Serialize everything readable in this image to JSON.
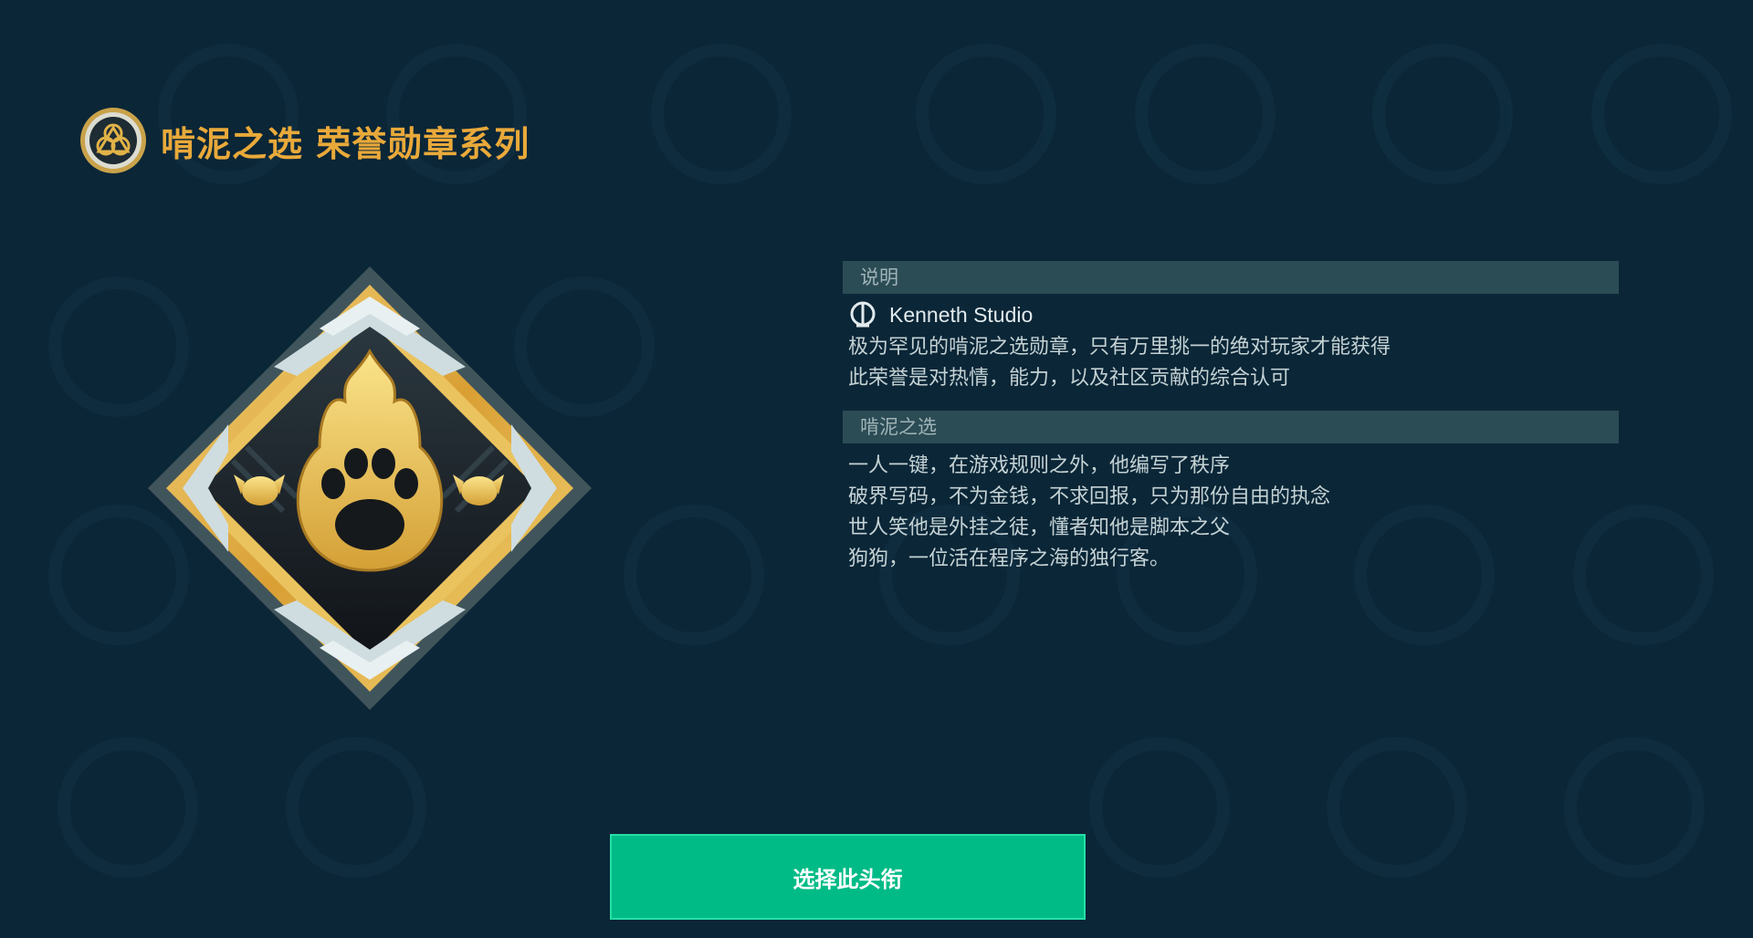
{
  "header": {
    "title": "啃泥之选 荣誉勋章系列",
    "emblem_icon": "trefoil-medal-icon"
  },
  "badge": {
    "icon": "paw-flame-badge-icon",
    "side_icons": [
      "dog-head-icon",
      "dog-head-icon"
    ]
  },
  "description": {
    "heading": "说明",
    "author_icon": "kenneth-studio-logo-icon",
    "author": "Kenneth Studio",
    "lines": [
      "极为罕见的啃泥之选勋章，只有万里挑一的绝对玩家才能获得",
      "此荣誉是对热情，能力，以及社区贡献的综合认可"
    ]
  },
  "lore": {
    "heading": "啃泥之选",
    "lines": [
      "一人一键，在游戏规则之外，他编写了秩序",
      "破界写码，不为金钱，不求回报，只为那份自由的执念",
      "世人笑他是外挂之徒，懂者知他是脚本之父",
      "狗狗，一位活在程序之海的独行客。"
    ]
  },
  "action": {
    "select_label": "选择此头衔"
  },
  "colors": {
    "background": "#0a2637",
    "accent_gold": "#e9a93a",
    "section_bar": "#2c4c55",
    "button": "#00bb86"
  }
}
